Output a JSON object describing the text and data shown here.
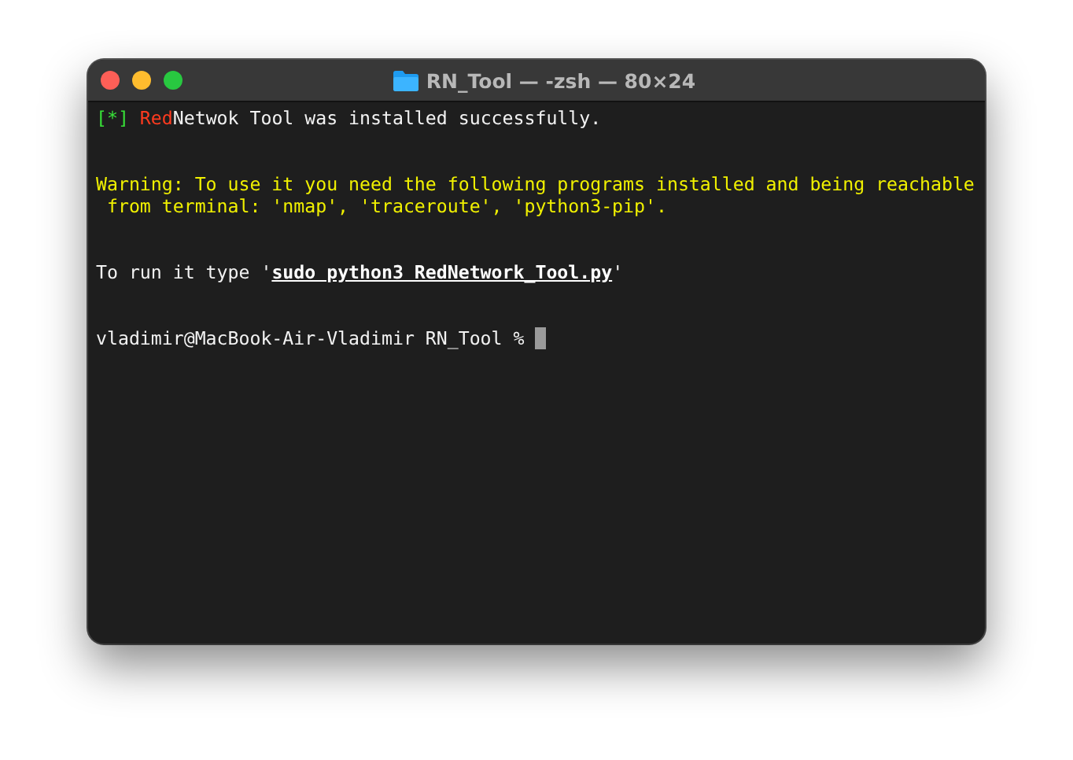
{
  "window": {
    "title": "RN_Tool — -zsh — 80×24"
  },
  "terminal": {
    "lines": [
      {
        "kind": "text",
        "segments": [
          {
            "kind": "success",
            "text": "[*] "
          },
          {
            "kind": "error",
            "text": "Red"
          },
          {
            "kind": "plain",
            "text": "Netwok Tool was installed successfully."
          }
        ]
      },
      {
        "kind": "blank"
      },
      {
        "kind": "blank"
      },
      {
        "kind": "text",
        "segments": [
          {
            "kind": "warning",
            "text": "Warning: To use it you need the following programs installed and being reachable"
          }
        ]
      },
      {
        "kind": "text",
        "segments": [
          {
            "kind": "warning",
            "text": " from terminal: 'nmap', 'traceroute', 'python3-pip'."
          }
        ]
      },
      {
        "kind": "blank"
      },
      {
        "kind": "blank"
      },
      {
        "kind": "text",
        "segments": [
          {
            "kind": "plain",
            "text": "To run it type '"
          },
          {
            "kind": "command",
            "text": "sudo python3 RedNetwork_Tool.py"
          },
          {
            "kind": "plain",
            "text": "'"
          }
        ]
      },
      {
        "kind": "blank"
      },
      {
        "kind": "blank"
      },
      {
        "kind": "prompt",
        "cursor": true,
        "segments": [
          {
            "kind": "plain",
            "text": "vladimir@MacBook-Air-Vladimir RN_Tool % "
          }
        ]
      }
    ]
  }
}
